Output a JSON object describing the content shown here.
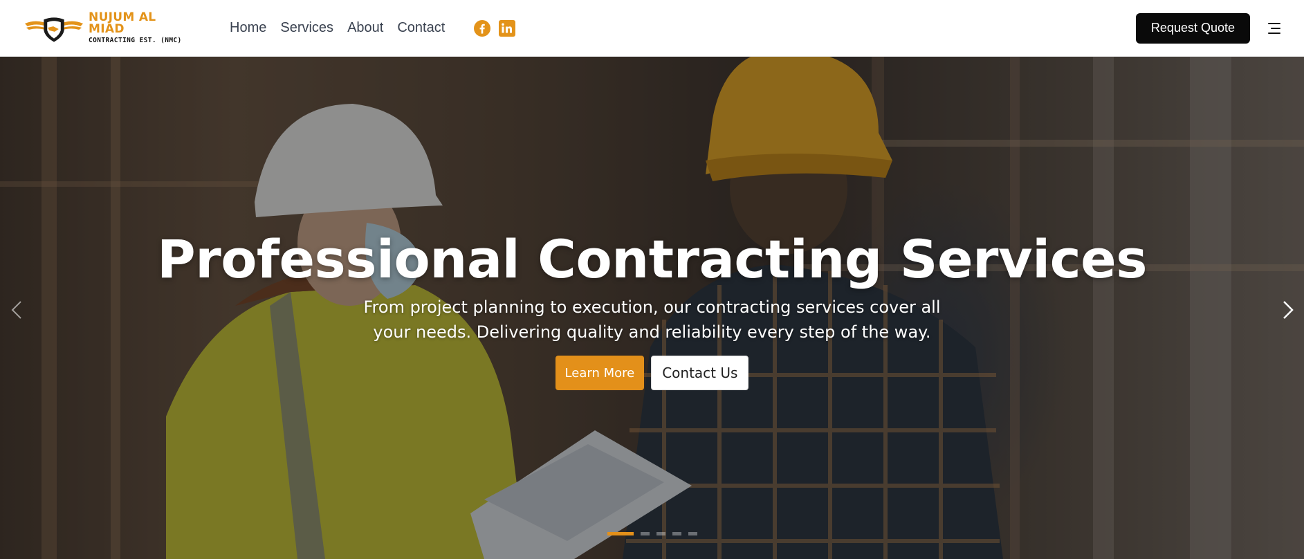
{
  "brand": {
    "name": "NUJUM AL MIAD",
    "subtitle": "CONTRACTING EST. (NMC)",
    "accent_color": "#E3931A",
    "logo_icon": "eagle-shield-logo"
  },
  "nav": {
    "items": [
      {
        "label": "Home"
      },
      {
        "label": "Services"
      },
      {
        "label": "About"
      },
      {
        "label": "Contact"
      }
    ]
  },
  "social": {
    "facebook_icon": "facebook-icon",
    "linkedin_icon": "linkedin-icon"
  },
  "header": {
    "quote_button": "Request Quote",
    "menu_icon": "hamburger-menu-icon"
  },
  "hero": {
    "title": "Professional Contracting Services",
    "subtitle": "From project planning to execution, our contracting services cover all your needs. Delivering quality and reliability every step of the way.",
    "primary_button": "Learn More",
    "secondary_button": "Contact Us",
    "button_color": "#E3901A",
    "slide_count": 5,
    "active_slide": 1
  }
}
